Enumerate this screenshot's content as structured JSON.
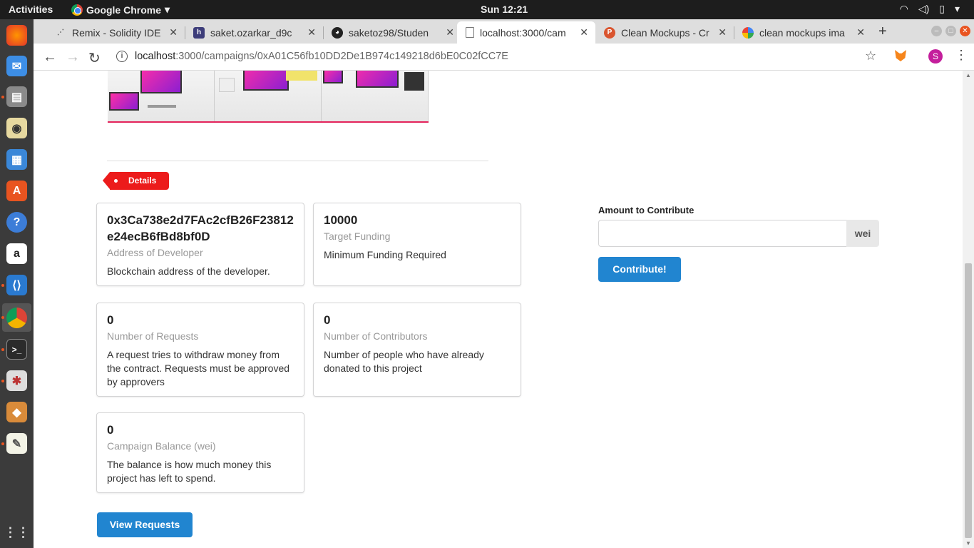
{
  "topbar": {
    "activities": "Activities",
    "app_name": "Google Chrome",
    "clock": "Sun 12:21"
  },
  "browser": {
    "tabs": [
      {
        "title": "Remix - Solidity IDE",
        "favicon": "remix-icon"
      },
      {
        "title": "saket.ozarkar_d9c",
        "favicon": "hackmd-icon"
      },
      {
        "title": "saketoz98/Studen",
        "favicon": "github-icon"
      },
      {
        "title": "localhost:3000/cam",
        "favicon": "page-icon"
      },
      {
        "title": "Clean Mockups - Cr",
        "favicon": "producthunt-icon"
      },
      {
        "title": "clean mockups ima",
        "favicon": "google-icon"
      }
    ],
    "active_tab_index": 3,
    "url_host": "localhost",
    "url_path": ":3000/campaigns/0xA01C56fb10DD2De1B974c149218d6bE0C02fCC7E",
    "profile_initial": "S"
  },
  "campaign": {
    "section_label": "Details",
    "cards": [
      {
        "header": "0x3Ca738e2d7FAc2cfB26F23812e24ecB6fBd8bf0D",
        "meta": "Address of Developer",
        "description": "Blockchain address of the developer."
      },
      {
        "header": "10000",
        "meta": "Target Funding",
        "description": "Minimum Funding Required"
      },
      {
        "header": "0",
        "meta": "Number of Requests",
        "description": "A request tries to withdraw money from the contract. Requests must be approved by approvers"
      },
      {
        "header": "0",
        "meta": "Number of Contributors",
        "description": "Number of people who have already donated to this project"
      },
      {
        "header": "0",
        "meta": "Campaign Balance (wei)",
        "description": "The balance is how much money this project has left to spend."
      }
    ],
    "view_requests_label": "View Requests"
  },
  "contribute": {
    "label": "Amount to Contribute",
    "value": "",
    "unit": "wei",
    "button_label": "Contribute!"
  },
  "colors": {
    "primary": "#2185d0",
    "ribbon": "#ec1b1b",
    "dock": "#3b3b3b"
  }
}
